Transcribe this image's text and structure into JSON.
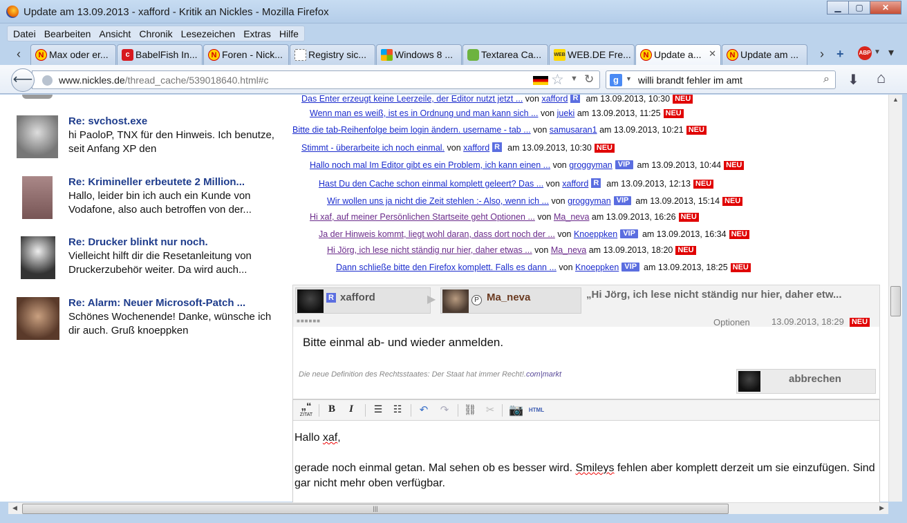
{
  "window": {
    "title": "Update am 13.09.2013 - xafford - Kritik an Nickles - Mozilla Firefox",
    "minimize": "▁",
    "maximize": "▢",
    "close": "✕"
  },
  "menu": [
    "Datei",
    "Bearbeiten",
    "Ansicht",
    "Chronik",
    "Lesezeichen",
    "Extras",
    "Hilfe"
  ],
  "tabs": [
    {
      "label": "Max oder er...",
      "icon": "nickles-icon"
    },
    {
      "label": "BabelFish In...",
      "icon": "babelfish-icon"
    },
    {
      "label": "Foren - Nick...",
      "icon": "nickles-icon"
    },
    {
      "label": "Registry sic...",
      "icon": "blank-page-icon"
    },
    {
      "label": "Windows 8 ...",
      "icon": "windows-icon"
    },
    {
      "label": "Textarea Ca...",
      "icon": "puzzle-icon"
    },
    {
      "label": "WEB.DE Fre...",
      "icon": "webde-icon"
    },
    {
      "label": "Update a...",
      "icon": "nickles-icon",
      "active": true
    },
    {
      "label": "Update am ...",
      "icon": "nickles-icon"
    }
  ],
  "nav": {
    "url_host": "www.nickles.de",
    "url_path": "/thread_cache/539018640.html#c",
    "search_value": "willi brandt fehler im amt",
    "abp": "ABP"
  },
  "sidebar": [
    {
      "title": "Re: svchost.exe",
      "text": "hi PaoloP, TNX für den Hinweis. Ich benutze, seit Anfang XP den"
    },
    {
      "title": "Re: Krimineller erbeutete 2 Million...",
      "text": "Hallo, leider bin ich auch ein Kunde von Vodafone, also auch betroffen von der..."
    },
    {
      "title": "Re: Drucker blinkt nur noch.",
      "text": "Vielleicht hilft dir die Resetanleitung von Druckerzubehör weiter. Da wird auch..."
    },
    {
      "title": "Re: Alarm: Neuer Microsoft-Patch ...",
      "text": "Schönes Wochenende! Danke, wünsche ich dir auch. Gruß knoeppken"
    }
  ],
  "thread": [
    {
      "link": "Das Enter erzeugt keine Leerzeile, der Editor nutzt jetzt ...",
      "von": "von",
      "user": "xafford",
      "badge": "R",
      "date": "am 13.09.2013, 10:30",
      "neu": "NEU"
    },
    {
      "link": "Wenn man es weiß, ist es in Ordnung und man kann sich ...",
      "von": "von",
      "user": "jueki",
      "badge": "",
      "date": "am 13.09.2013, 11:25",
      "neu": "NEU"
    },
    {
      "link": "Bitte die tab-Reihenfolge beim login ändern. username - tab ...",
      "von": "von",
      "user": "samusaran1",
      "badge": "",
      "date": "am 13.09.2013, 10:21",
      "neu": "NEU"
    },
    {
      "link": "Stimmt - überarbeite ich noch einmal.",
      "von": "von",
      "user": "xafford",
      "badge": "R",
      "date": "am 13.09.2013, 10:30",
      "neu": "NEU"
    },
    {
      "link": "Hallo noch mal Im Editor gibt es ein Problem, ich kann einen ...",
      "von": "von",
      "user": "groggyman",
      "badge": "VIP",
      "date": "am 13.09.2013, 10:44",
      "neu": "NEU"
    },
    {
      "link": "Hast Du den Cache schon einmal komplett geleert? Das ...",
      "von": "von",
      "user": "xafford",
      "badge": "R",
      "date": "am 13.09.2013, 12:13",
      "neu": "NEU"
    },
    {
      "link": "Wir wollen uns ja nicht die Zeit stehlen :- Also, wenn ich ...",
      "von": "von",
      "user": "groggyman",
      "badge": "VIP",
      "date": "am 13.09.2013, 15:14",
      "neu": "NEU"
    },
    {
      "link": "Hi xaf, auf meiner Persönlichen Startseite geht Optionen ...",
      "von": "von",
      "user": "Ma_neva",
      "badge": "",
      "date": "am 13.09.2013, 16:26",
      "neu": "NEU"
    },
    {
      "link": "Ja der Hinweis kommt, liegt wohl daran, dass dort noch der ...",
      "von": "von",
      "user": "Knoeppken",
      "badge": "VIP",
      "date": "am 13.09.2013, 16:34",
      "neu": "NEU"
    },
    {
      "link": "Hi Jörg, ich lese nicht ständig nur hier, daher etwas ...",
      "von": "von",
      "user": "Ma_neva",
      "badge": "",
      "date": "am 13.09.2013, 18:20",
      "neu": "NEU"
    },
    {
      "link": "Dann schließe bitte den Firefox komplett. Falls es dann ...",
      "von": "von",
      "user": "Knoeppken",
      "badge": "VIP",
      "date": "am 13.09.2013, 18:25",
      "neu": "NEU"
    }
  ],
  "post": {
    "from_user": "xafford",
    "from_badge": "R",
    "to_user": "Ma_neva",
    "to_badge": "P",
    "quote": "„Hi Jörg, ich lese nicht ständig nur hier, daher etw...",
    "dots": "■■■■■■",
    "optionen": "Optionen",
    "date": "13.09.2013, 18:29",
    "neu": "NEU",
    "body": "Bitte einmal ab- und wieder anmelden.",
    "signature": "Die neue Definition des Rechtsstaates: Der Staat hat immer Recht!.",
    "signature_link": "com|markt",
    "cancel": "abbrechen"
  },
  "editor": {
    "quote_btn": "„“",
    "quote_label": "ZITAT",
    "bold": "B",
    "italic": "I",
    "html": "HTML",
    "line1_a": "Hallo ",
    "line1_b": "xaf",
    "line1_c": ",",
    "line2_a": "gerade noch einmal getan. Mal sehen ob es besser wird. ",
    "line2_b": "Smileys",
    "line2_c": " fehlen aber komplett derzeit um sie einzufügen. Sind gar nicht mehr oben verfügbar."
  }
}
